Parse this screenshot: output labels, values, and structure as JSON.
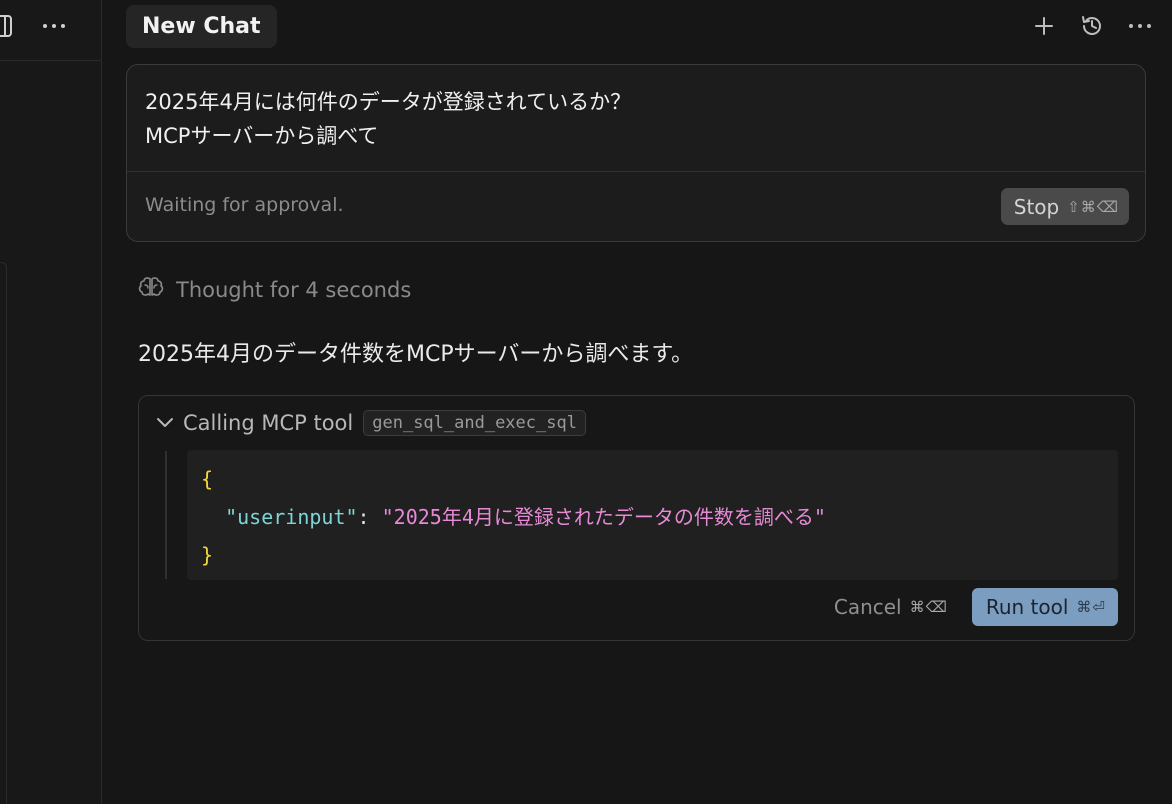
{
  "chat": {
    "tab_title": "New Chat"
  },
  "message": {
    "text": "2025年4月には何件のデータが登録されているか？\nMCPサーバーから調べて",
    "status": "Waiting for approval.",
    "stop_label": "Stop",
    "stop_shortcut": "⇧⌘⌫"
  },
  "thought": {
    "label": "Thought for 4 seconds",
    "icon": "brain-icon"
  },
  "reply": {
    "text": "2025年4月のデータ件数をMCPサーバーから調べます。"
  },
  "tool_call": {
    "label": "Calling MCP tool",
    "tool_name": "gen_sql_and_exec_sql",
    "args": {
      "open_brace": "{",
      "key": "\"userinput\"",
      "colon": ":",
      "value": "\"2025年4月に登録されたデータの件数を調べる\"",
      "close_brace": "}"
    },
    "cancel_label": "Cancel",
    "cancel_shortcut": "⌘⌫",
    "run_label": "Run tool",
    "run_shortcut": "⌘⏎"
  },
  "colors": {
    "background": "#161616",
    "accent": "#7b9ec0",
    "json_key": "#7fd4d4",
    "json_value": "#e68ad6",
    "brace": "#f5d93a"
  }
}
